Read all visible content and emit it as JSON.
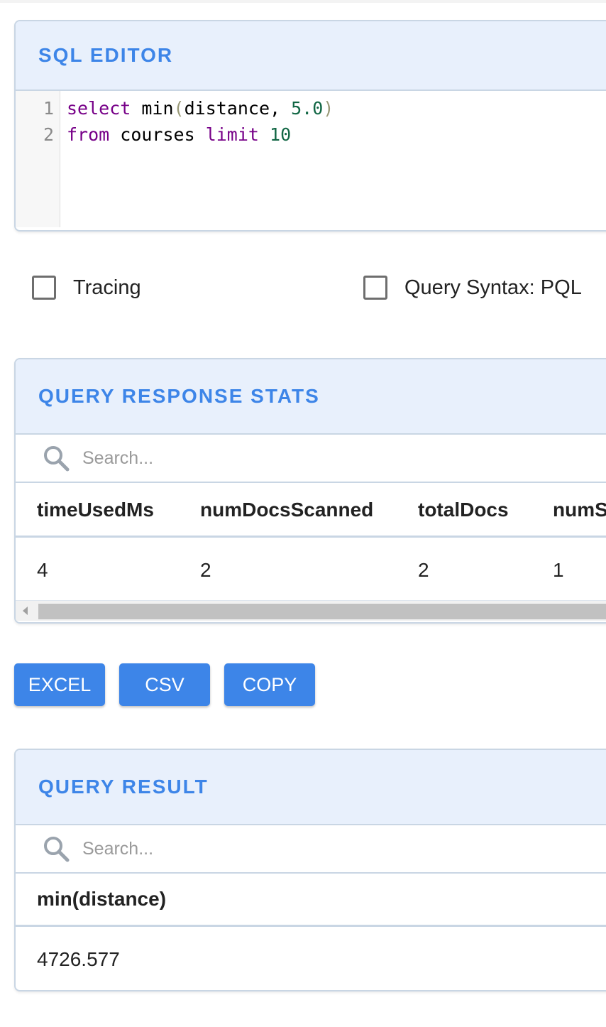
{
  "editor": {
    "title": "SQL EDITOR",
    "lines": [
      {
        "number": "1",
        "tokens": [
          "select",
          "min",
          "(",
          "distance, ",
          "5.0",
          ")"
        ]
      },
      {
        "number": "2",
        "tokens": [
          "from",
          "courses",
          "limit",
          "10"
        ]
      }
    ]
  },
  "options": {
    "tracing_label": "Tracing",
    "tracing_checked": false,
    "syntax_label": "Query Syntax: PQL",
    "syntax_checked": false
  },
  "stats": {
    "title": "QUERY RESPONSE STATS",
    "search_placeholder": "Search...",
    "columns": [
      "timeUsedMs",
      "numDocsScanned",
      "totalDocs",
      "numS"
    ],
    "rows": [
      [
        "4",
        "2",
        "2",
        "1"
      ]
    ]
  },
  "export": {
    "excel_label": "EXCEL",
    "csv_label": "CSV",
    "copy_label": "COPY"
  },
  "result": {
    "title": "QUERY RESULT",
    "search_placeholder": "Search...",
    "columns": [
      "min(distance)"
    ],
    "rows": [
      [
        "4726.577"
      ]
    ]
  },
  "colors": {
    "accent": "#3d85e8",
    "header_bg": "#e8f0fc",
    "keyword": "#770088",
    "number": "#116644"
  },
  "icons": [
    "search-icon",
    "scroll-left-arrow-icon"
  ]
}
